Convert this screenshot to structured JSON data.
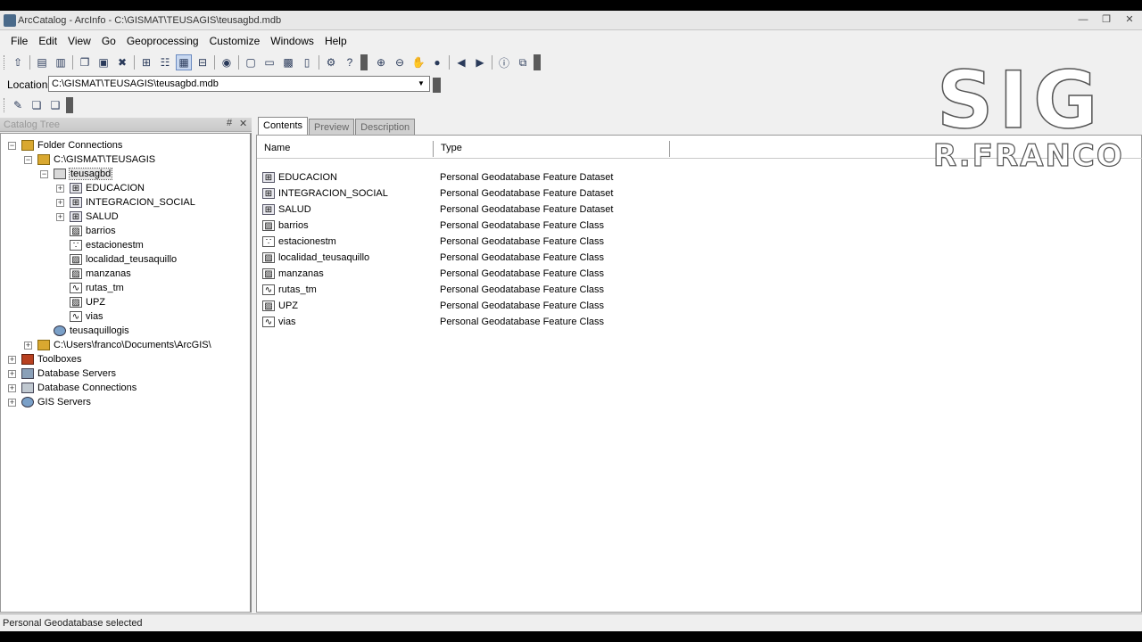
{
  "window": {
    "title": "ArcCatalog - ArcInfo - C:\\GISMAT\\TEUSAGIS\\teusagbd.mdb",
    "controls": [
      "—",
      "❐",
      "✕"
    ]
  },
  "menu": [
    "File",
    "Edit",
    "View",
    "Go",
    "Geoprocessing",
    "Customize",
    "Windows",
    "Help"
  ],
  "location": {
    "label": "Location:",
    "value": "C:\\GISMAT\\TEUSAGIS\\teusagbd.mdb"
  },
  "catalog_tree": {
    "title": "Catalog Tree",
    "pin": "#",
    "close": "✕",
    "nodes": [
      {
        "label": "Folder Connections"
      },
      {
        "label": "C:\\GISMAT\\TEUSAGIS"
      },
      {
        "label": "teusagbd"
      },
      {
        "label": "EDUCACION"
      },
      {
        "label": "INTEGRACION_SOCIAL"
      },
      {
        "label": "SALUD"
      },
      {
        "label": "barrios"
      },
      {
        "label": "estacionestm"
      },
      {
        "label": "localidad_teusaquillo"
      },
      {
        "label": "manzanas"
      },
      {
        "label": "rutas_tm"
      },
      {
        "label": "UPZ"
      },
      {
        "label": "vias"
      },
      {
        "label": "teusaquillogis"
      },
      {
        "label": "C:\\Users\\franco\\Documents\\ArcGIS\\"
      },
      {
        "label": "Toolboxes"
      },
      {
        "label": "Database Servers"
      },
      {
        "label": "Database Connections"
      },
      {
        "label": "GIS Servers"
      }
    ]
  },
  "tabs": [
    "Contents",
    "Preview",
    "Description"
  ],
  "contents": {
    "columns": [
      "Name",
      "Type"
    ],
    "rows": [
      {
        "name": "EDUCACION",
        "type": "Personal Geodatabase Feature Dataset",
        "icon": "feature-dataset-icon"
      },
      {
        "name": "INTEGRACION_SOCIAL",
        "type": "Personal Geodatabase Feature Dataset",
        "icon": "feature-dataset-icon"
      },
      {
        "name": "SALUD",
        "type": "Personal Geodatabase Feature Dataset",
        "icon": "feature-dataset-icon"
      },
      {
        "name": "barrios",
        "type": "Personal Geodatabase Feature Class",
        "icon": "polygon-feature-class-icon"
      },
      {
        "name": "estacionestm",
        "type": "Personal Geodatabase Feature Class",
        "icon": "point-feature-class-icon"
      },
      {
        "name": "localidad_teusaquillo",
        "type": "Personal Geodatabase Feature Class",
        "icon": "polygon-feature-class-icon"
      },
      {
        "name": "manzanas",
        "type": "Personal Geodatabase Feature Class",
        "icon": "polygon-feature-class-icon"
      },
      {
        "name": "rutas_tm",
        "type": "Personal Geodatabase Feature Class",
        "icon": "line-feature-class-icon"
      },
      {
        "name": "UPZ",
        "type": "Personal Geodatabase Feature Class",
        "icon": "polygon-feature-class-icon"
      },
      {
        "name": "vias",
        "type": "Personal Geodatabase Feature Class",
        "icon": "line-feature-class-icon"
      }
    ]
  },
  "status": "Personal Geodatabase selected",
  "watermark": {
    "main": "SIG",
    "sub": "R.FRANCO"
  }
}
